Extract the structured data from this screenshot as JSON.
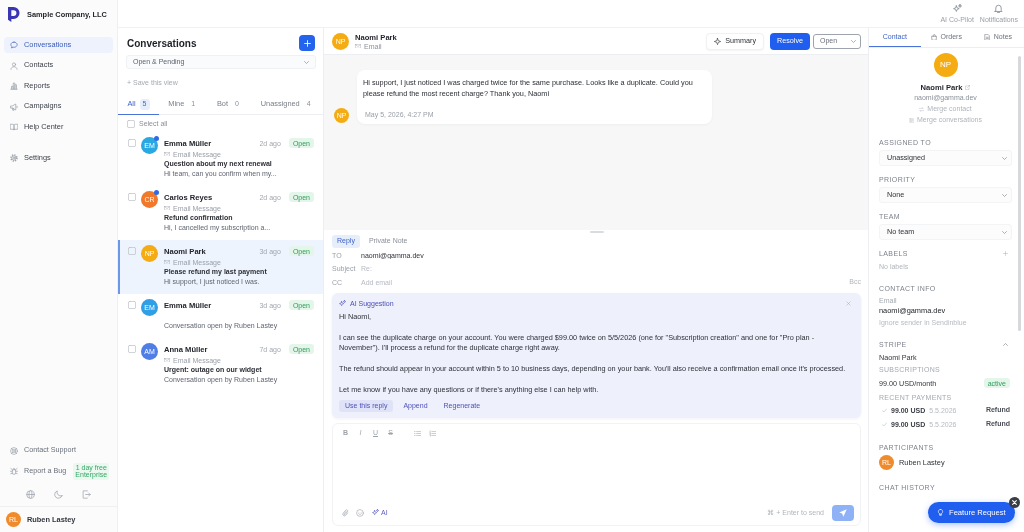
{
  "brand": {
    "name": "Sample Company, LLC"
  },
  "sidebar": {
    "sections": [
      {
        "items": [
          {
            "label": "Conversations",
            "selected": true
          },
          {
            "label": "Contacts",
            "selected": false
          },
          {
            "label": "Reports",
            "selected": false
          },
          {
            "label": "Campaigns",
            "selected": false
          },
          {
            "label": "Help Center",
            "selected": false
          }
        ]
      },
      {
        "items": [
          {
            "label": "Settings",
            "selected": false
          }
        ]
      }
    ],
    "footer_links": [
      {
        "label": "Contact Support"
      },
      {
        "label": "Report a Bug",
        "badge": "1 day free Enterprise"
      }
    ],
    "user": {
      "initials": "RL",
      "name": "Ruben Lastey"
    }
  },
  "top_bar": {
    "actions": [
      {
        "label": "AI Co-Pilot"
      },
      {
        "label": "Notifications"
      }
    ]
  },
  "conversation_list": {
    "title": "Conversations",
    "filter": "Open & Pending",
    "save_view": "+ Save this view",
    "tabs": [
      {
        "label": "All",
        "count": "5",
        "selected": true
      },
      {
        "label": "Mine",
        "count": "1",
        "selected": false
      },
      {
        "label": "Bot",
        "count": "0",
        "selected": false
      },
      {
        "label": "Unassigned",
        "count": "4",
        "selected": false
      }
    ],
    "select_all": {
      "label": "Select all",
      "checked": false
    },
    "items": [
      {
        "initials": "EM",
        "color": "#2aa8e4",
        "unread": true,
        "name": "Emma Müller",
        "time": "2d ago",
        "status": "Open",
        "channel": "Email Message",
        "subject": "Question about my next renewal",
        "preview": "Hi team, can you confirm when my...",
        "checked": false,
        "selected": false
      },
      {
        "initials": "CR",
        "color": "#f2782a",
        "unread": true,
        "name": "Carlos Reyes",
        "time": "2d ago",
        "status": "Open",
        "channel": "Email Message",
        "subject": "Refund confirmation",
        "preview": "Hi, I cancelled my subscription a...",
        "checked": false,
        "selected": false
      },
      {
        "initials": "NP",
        "color": "#f5ab12",
        "unread": false,
        "name": "Naomi Park",
        "time": "3d ago",
        "status": "Open",
        "channel": "Email Message",
        "subject": "Please refund my last payment",
        "preview": "Hi support, I just noticed I was.",
        "checked": false,
        "selected": true
      },
      {
        "initials": "EM",
        "color": "#2f9fe8",
        "unread": false,
        "name": "Emma Müller",
        "time": "3d ago",
        "status": "Open",
        "preview": "Conversation open by Ruben Lastey",
        "checked": false,
        "selected": false
      },
      {
        "initials": "AM",
        "color": "#4f7fe6",
        "unread": false,
        "name": "Anna Müller",
        "time": "7d ago",
        "status": "Open",
        "channel": "Email Message",
        "subject": "Urgent: outage on our widget",
        "preview": "Conversation open by Ruben Lastey",
        "checked": false,
        "selected": false
      }
    ]
  },
  "conversation": {
    "contact": {
      "initials": "NP",
      "name": "Naomi Park",
      "channel": "Email"
    },
    "summary_button": "Summary",
    "resolve_button": "Resolve",
    "status": "Open",
    "messages": [
      {
        "initials": "NP",
        "text": "Hi support, I just noticed I was charged twice for the same purchase. Looks like a duplicate. Could you please refund the most recent charge? Thank you, Naomi",
        "time": "May 5, 2026, 4:27 PM"
      }
    ]
  },
  "composer": {
    "tabs": [
      {
        "label": "Reply",
        "selected": true
      },
      {
        "label": "Private Note",
        "selected": false
      }
    ],
    "fields": [
      {
        "label": "TO",
        "value": "naomi@gamma.dev"
      },
      {
        "label": "Subject",
        "placeholder": "Re:"
      },
      {
        "label": "CC",
        "placeholder": "Add email",
        "extra": "Bcc"
      }
    ],
    "ai_suggestion": {
      "title": "AI Suggestion",
      "paragraphs": [
        "Hi Naomi,",
        "I can see the duplicate charge on your account. You were charged $99.00 twice on 5/5/2026 (one for \"Subscription creation\" and one for \"Pro plan - November\"). I'll process a refund for the duplicate charge right away.",
        "The refund should appear in your account within 5 to 10 business days, depending on your bank. You'll also receive a confirmation email once it's processed.",
        "Let me know if you have any questions or if there's anything else I can help with."
      ],
      "actions": [
        {
          "label": "Use this reply",
          "kind": "primary"
        },
        {
          "label": "Append",
          "kind": "link"
        },
        {
          "label": "Regenerate",
          "kind": "link"
        }
      ]
    },
    "formatting": [
      {
        "label": "B",
        "kind": "bold"
      },
      {
        "label": "I",
        "kind": "italic"
      },
      {
        "label": "U",
        "kind": "underline"
      },
      {
        "label": "S",
        "kind": "strike"
      }
    ],
    "ai_button": "AI",
    "send_hint": "⌘ + Enter to send"
  },
  "details_panel": {
    "tabs": [
      {
        "label": "Contact",
        "selected": true
      },
      {
        "label": "Orders",
        "selected": false
      },
      {
        "label": "Notes",
        "selected": false
      }
    ],
    "contact": {
      "initials": "NP",
      "name": "Naomi Park",
      "email": "naomi@gamma.dev",
      "actions": [
        "Merge contact",
        "Merge conversations"
      ]
    },
    "selects": [
      {
        "label": "ASSIGNED TO",
        "value": "Unassigned"
      },
      {
        "label": "PRIORITY",
        "value": "None"
      },
      {
        "label": "TEAM",
        "value": "No team"
      }
    ],
    "labels": {
      "title": "LABELS",
      "empty": "No labels"
    },
    "contact_info": {
      "title": "CONTACT INFO",
      "field_label": "Email",
      "value": "naomi@gamma.dev",
      "note": "Ignore sender in Sendinblue"
    },
    "stripe": {
      "title": "STRIPE",
      "expanded": true,
      "customer": "Naomi Park",
      "subscriptions_title": "SUBSCRIPTIONS",
      "subscriptions": [
        {
          "plan": "99.00 USD/month",
          "status": "active"
        }
      ],
      "payments_title": "RECENT PAYMENTS",
      "payments": [
        {
          "amount": "99.00 USD",
          "date": "5.5.2026",
          "action": "Refund"
        },
        {
          "amount": "99.00 USD",
          "date": "5.5.2026",
          "action": "Refund"
        }
      ]
    },
    "participants": {
      "title": "PARTICIPANTS",
      "people": [
        {
          "initials": "RL",
          "name": "Ruben Lastey"
        }
      ]
    },
    "chat_history": {
      "title": "CHAT HISTORY"
    }
  },
  "feature_request": {
    "label": "Feature Request"
  }
}
